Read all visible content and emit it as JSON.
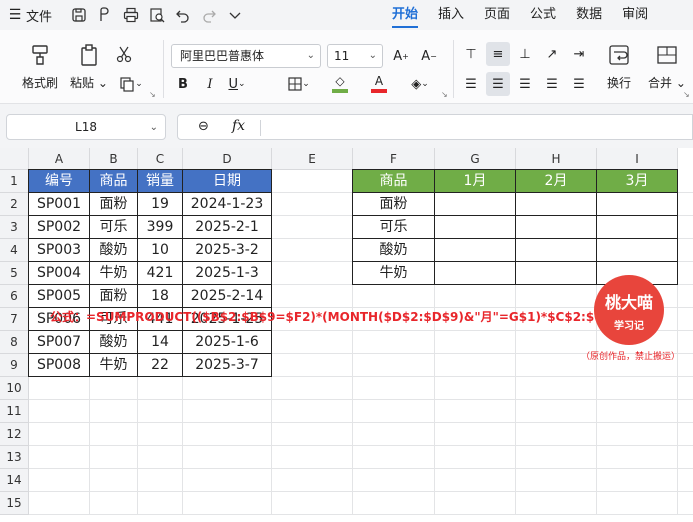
{
  "menubar": {
    "file_label": "文件",
    "tabs": [
      "开始",
      "插入",
      "页面",
      "公式",
      "数据",
      "审阅"
    ],
    "active_tab": "开始"
  },
  "ribbon": {
    "format_painter": "格式刷",
    "paste": "粘贴",
    "font_name": "阿里巴巴普惠体",
    "font_size": "11",
    "wrap_text": "换行",
    "merge": "合并",
    "fill_color": "#70ad47",
    "font_color": "#e8262b"
  },
  "formula_bar": {
    "name_box": "L18",
    "fx_label": "fx",
    "content": ""
  },
  "grid": {
    "columns": [
      "A",
      "B",
      "C",
      "D",
      "E",
      "F",
      "G",
      "H",
      "I"
    ],
    "rows": [
      "1",
      "2",
      "3",
      "4",
      "5",
      "6",
      "7",
      "8",
      "9",
      "10",
      "11",
      "12",
      "13",
      "14",
      "15"
    ],
    "table1": {
      "headers": [
        "编号",
        "商品",
        "销量",
        "日期"
      ],
      "rows": [
        [
          "SP001",
          "面粉",
          "19",
          "2024-1-23"
        ],
        [
          "SP002",
          "可乐",
          "399",
          "2025-2-1"
        ],
        [
          "SP003",
          "酸奶",
          "10",
          "2025-3-2"
        ],
        [
          "SP004",
          "牛奶",
          "421",
          "2025-1-3"
        ],
        [
          "SP005",
          "面粉",
          "18",
          "2025-2-14"
        ],
        [
          "SP006",
          "可乐",
          "441",
          "2025-1-25"
        ],
        [
          "SP007",
          "酸奶",
          "14",
          "2025-1-6"
        ],
        [
          "SP008",
          "牛奶",
          "22",
          "2025-3-7"
        ]
      ],
      "header_color": "#4472c4"
    },
    "table2": {
      "headers": [
        "商品",
        "1月",
        "2月",
        "3月"
      ],
      "items": [
        "面粉",
        "可乐",
        "酸奶",
        "牛奶"
      ],
      "header_color": "#70ad47"
    }
  },
  "annotation": {
    "formula_text": "公式：=SUMPRODUCT(($B$2:$B$9=$F2)*(MONTH($D$2:$D$9)&\"月\"=G$1)*$C$2:$C$9)",
    "stamp_line1": "桃大喵",
    "stamp_line2": "学习记",
    "note": "（原创作品，禁止搬运）"
  }
}
